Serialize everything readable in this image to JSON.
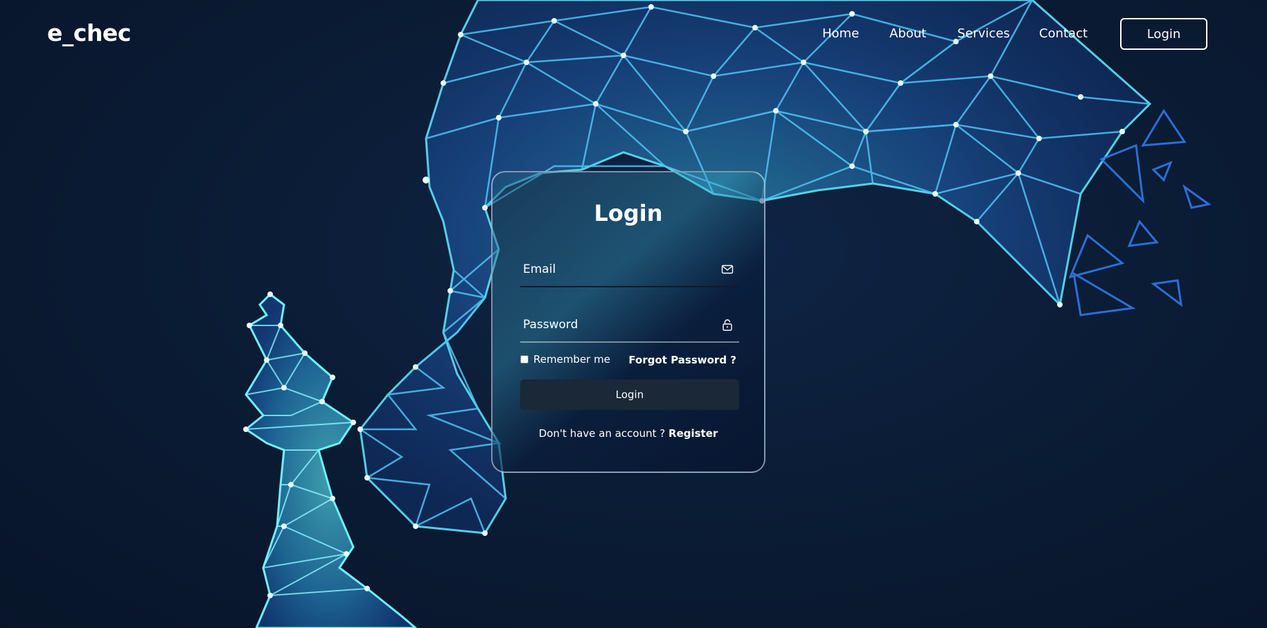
{
  "brand": {
    "logo": "e_chec"
  },
  "nav": {
    "items": [
      {
        "label": "Home"
      },
      {
        "label": "About"
      },
      {
        "label": "Services"
      },
      {
        "label": "Contact"
      }
    ],
    "login_button": "Login"
  },
  "login_form": {
    "title": "Login",
    "email": {
      "placeholder": "Email",
      "value": "",
      "icon": "mail-icon"
    },
    "password": {
      "placeholder": "Password",
      "value": "",
      "icon": "lock-icon"
    },
    "remember_label": "Remember me",
    "remember_checked": false,
    "forgot_label": "Forgot Password ?",
    "submit_label": "Login",
    "register_prompt": "Don't have an account ?",
    "register_link": "Register"
  },
  "colors": {
    "background": "#0b1c36",
    "accent_cyan": "#40d8f5",
    "accent_blue": "#2a6ae0",
    "button_dark": "#1a2838"
  }
}
